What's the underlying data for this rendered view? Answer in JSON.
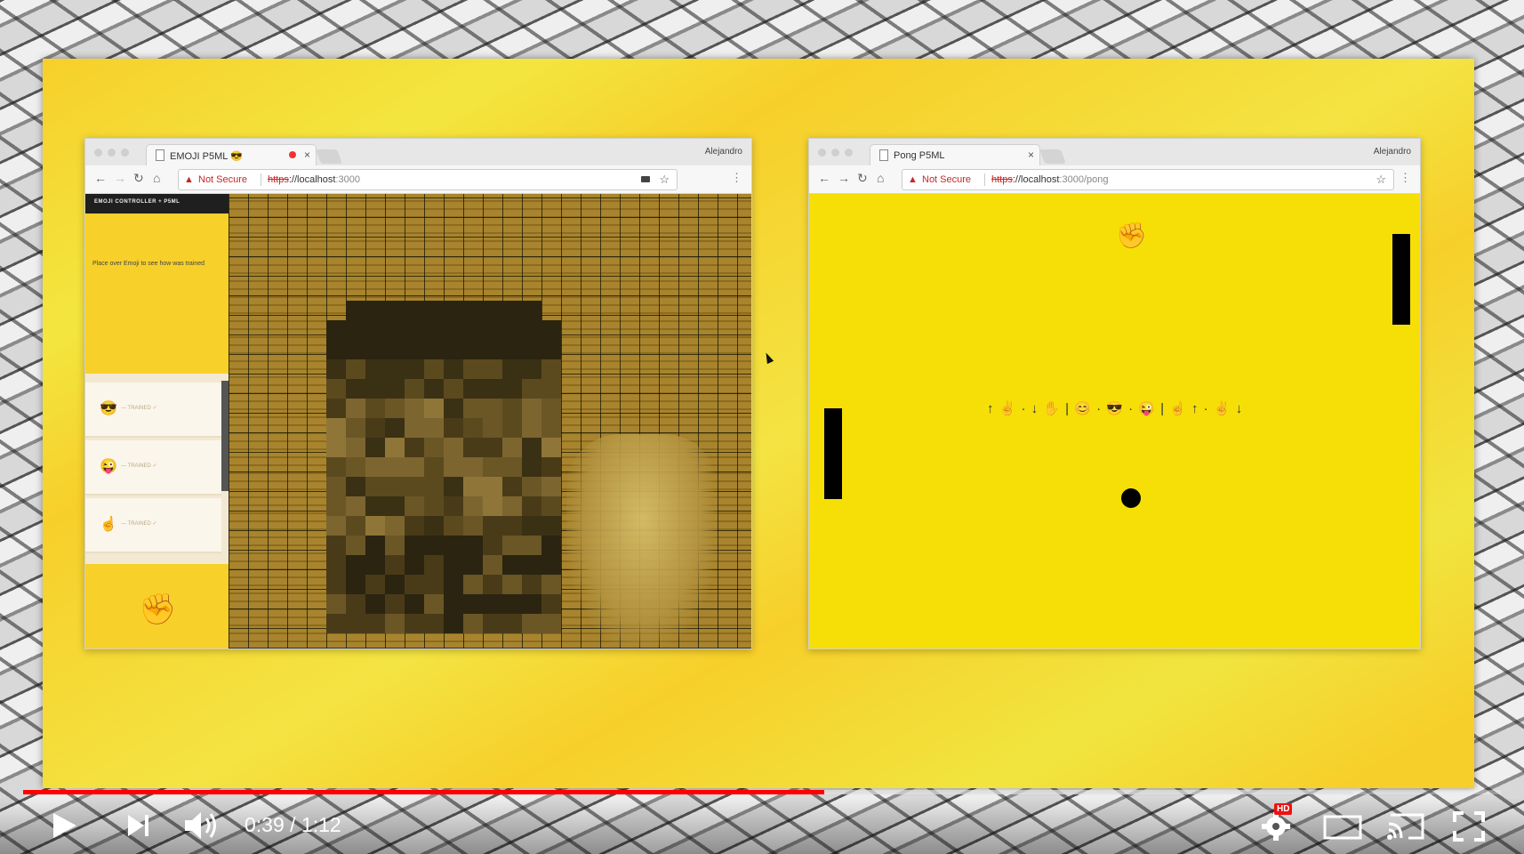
{
  "browser_left": {
    "tab_title": "EMOJI P5ML 😎",
    "user": "Alejandro",
    "security_label": "Not Secure",
    "url_scheme": "https",
    "url_host": "://localhost",
    "url_port": ":3000",
    "sidebar_header": "EMOJI CONTROLLER + P5ML",
    "sidebar_hint": "Place over Emoji to see how was trained",
    "cards": [
      {
        "emoji": "😎",
        "label": "— TRAINED ✓"
      },
      {
        "emoji": "😜",
        "label": "— TRAINED ✓"
      },
      {
        "emoji": "☝️",
        "label": "— TRAINED ✓"
      }
    ],
    "current_emoji": "✊"
  },
  "browser_right": {
    "tab_title": "Pong P5ML",
    "user": "Alejandro",
    "security_label": "Not Secure",
    "url_scheme": "https",
    "url_host": "://localhost",
    "url_path": ":3000/pong",
    "top_emoji": "✊",
    "legend": "↑ ✌ · ↓ ✋ | 😊 · 😎 · 😜 | ☝ ↑ · ✌ ↓"
  },
  "player": {
    "current_time": "0:39",
    "duration": "1:12",
    "time_display": "0:39 / 1:12",
    "played_fraction": 0.542,
    "buffered_fraction": 0.9,
    "hd_badge": "HD",
    "colors": {
      "progress": "#ff0000",
      "slide": "#f7cf2a",
      "pong_bg": "#f6df06"
    }
  }
}
